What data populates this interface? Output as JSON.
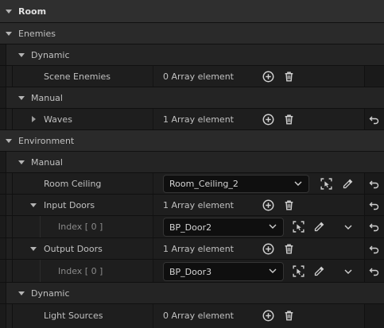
{
  "categories": {
    "room": "Room",
    "enemies": "Enemies",
    "enemies_dynamic": "Dynamic",
    "enemies_manual": "Manual",
    "environment": "Environment",
    "env_manual": "Manual",
    "env_dynamic": "Dynamic"
  },
  "properties": {
    "scene_enemies": {
      "name": "Scene Enemies",
      "value": "0 Array element"
    },
    "waves": {
      "name": "Waves",
      "value": "1 Array element"
    },
    "room_ceiling": {
      "name": "Room Ceiling",
      "value": "Room_Ceiling_2"
    },
    "input_doors": {
      "name": "Input Doors",
      "value": "1 Array element"
    },
    "input_doors_index0": {
      "name": "Index [ 0 ]",
      "value": "BP_Door2"
    },
    "output_doors": {
      "name": "Output Doors",
      "value": "1 Array element"
    },
    "output_doors_index0": {
      "name": "Index [ 0 ]",
      "value": "BP_Door3"
    },
    "light_sources": {
      "name": "Light Sources",
      "value": "0 Array element"
    }
  },
  "colors": {
    "panel_bg": "#151515",
    "header_bg": "#2a2a2a",
    "row_bg": "#1e1e1e",
    "combo_bg": "#0f0f0f",
    "text": "#c0c0c0",
    "icon": "#cfcfcf"
  },
  "icons": {
    "expand": "triangle-down-icon",
    "collapsed": "triangle-right-icon",
    "add": "plus-circle-icon",
    "delete": "trash-icon",
    "browse": "select-actor-icon",
    "picker": "eyedropper-icon",
    "reset": "reset-arrow-icon",
    "dropdown": "chevron-down-icon"
  }
}
